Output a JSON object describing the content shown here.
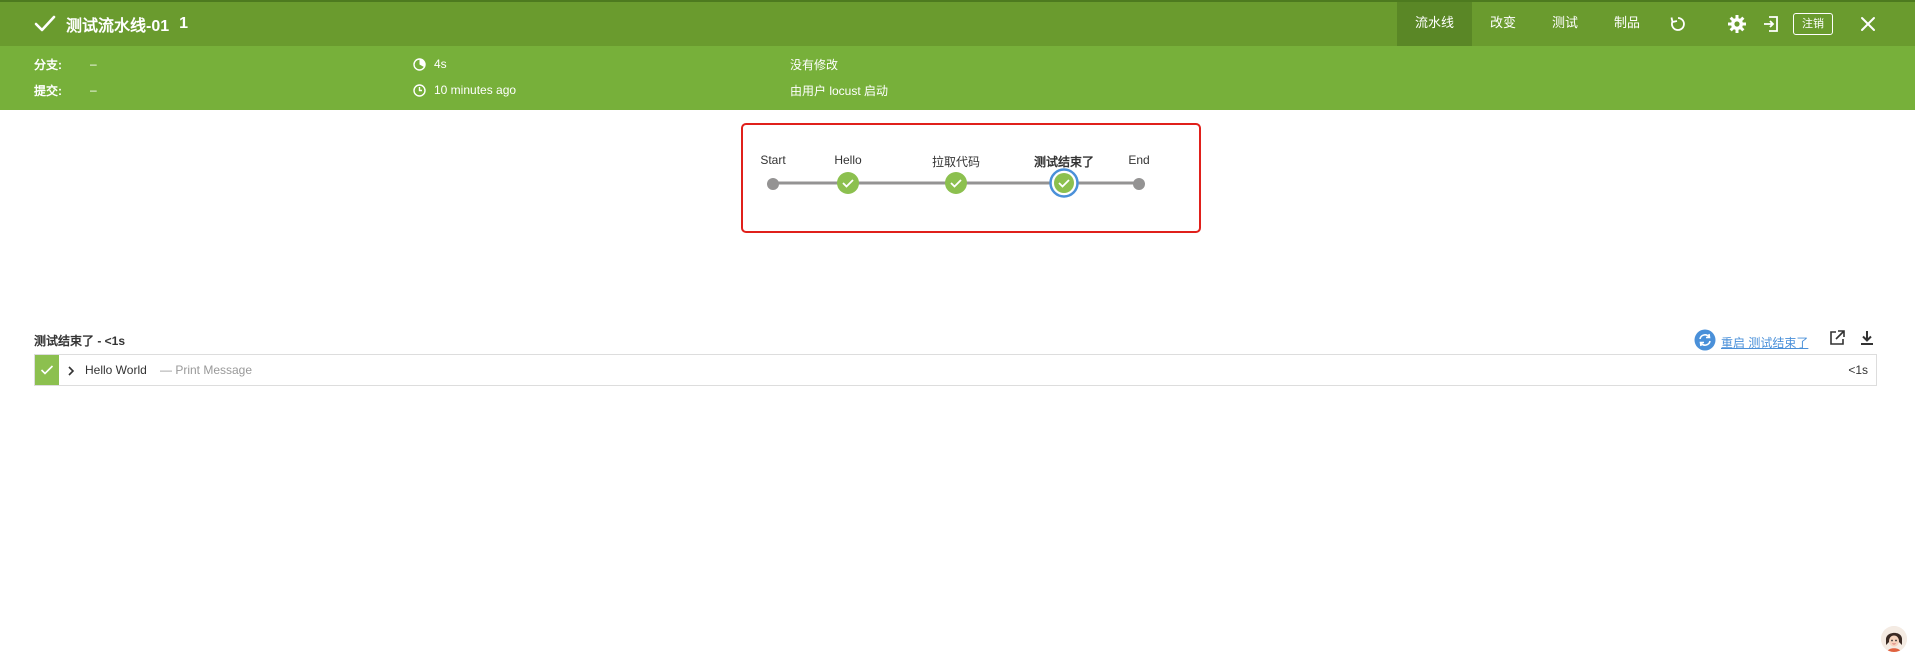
{
  "header": {
    "title": "测试流水线-01",
    "run_number": "1",
    "tabs": [
      {
        "label": "流水线",
        "active": true
      },
      {
        "label": "改变",
        "active": false
      },
      {
        "label": "测试",
        "active": false
      },
      {
        "label": "制品",
        "active": false
      }
    ],
    "icons": [
      "replay-icon",
      "gear-icon",
      "exit-icon",
      "close-icon"
    ],
    "logout_label": "注销"
  },
  "info": {
    "branch_label": "分支:",
    "branch_value": "–",
    "commit_label": "提交:",
    "commit_value": "–",
    "duration": "4s",
    "time_ago": "10 minutes ago",
    "changes": "没有修改",
    "started_by": "由用户 locust 启动"
  },
  "pipeline": {
    "stages": [
      {
        "label": "Start",
        "type": "endpoint"
      },
      {
        "label": "Hello",
        "type": "success"
      },
      {
        "label": "拉取代码",
        "type": "success"
      },
      {
        "label": "测试结束了",
        "type": "success",
        "selected": true
      },
      {
        "label": "End",
        "type": "endpoint"
      }
    ]
  },
  "stage_detail": {
    "title": "测试结束了 - <1s",
    "restart_label": "重启 测试结束了",
    "steps": [
      {
        "name": "Hello World",
        "description": "— Print Message",
        "duration": "<1s",
        "status": "success"
      }
    ]
  },
  "colors": {
    "header_bg": "#6a9b2e",
    "infobar_bg": "#77b03a",
    "success": "#8cc04f",
    "highlight_border": "#e0201b",
    "selected_ring": "#4a90d9"
  }
}
